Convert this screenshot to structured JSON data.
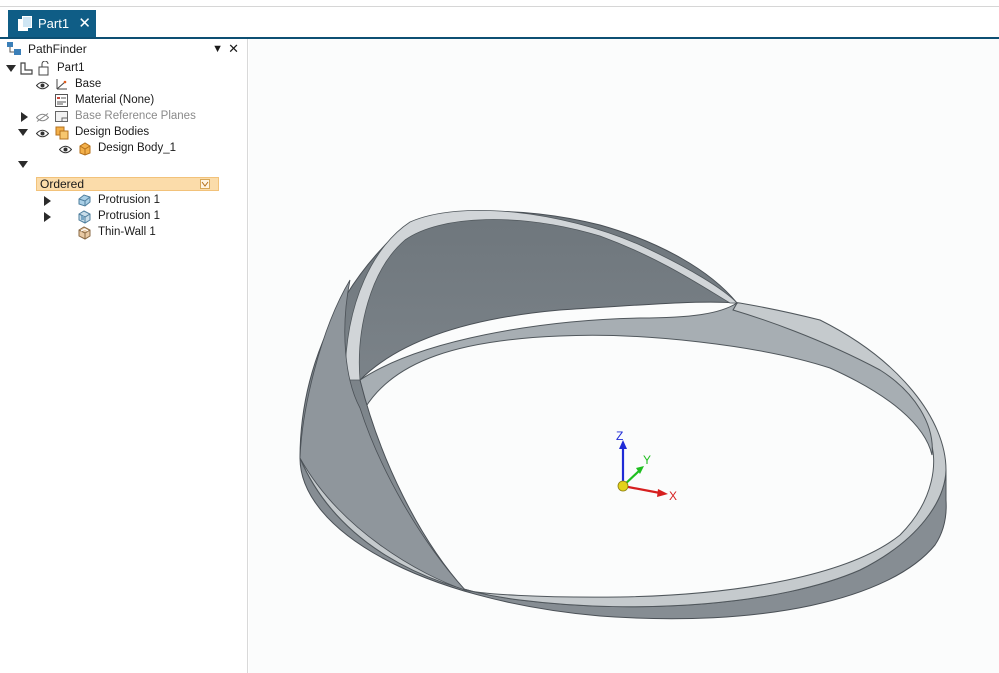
{
  "tabs": [
    {
      "label": "Part1",
      "close_glyph": "✕",
      "icon": "part-document-icon"
    }
  ],
  "pathfinder": {
    "title": "PathFinder",
    "pin_glyph": "▼",
    "close_glyph": "✕",
    "tree": {
      "root": "Part1",
      "base": "Base",
      "material": "Material (None)",
      "base_reference_planes": "Base Reference Planes",
      "design_bodies": "Design Bodies",
      "design_body_1": "Design Body_1",
      "ordered": "Ordered",
      "features": [
        "Protrusion 1",
        "Protrusion 1",
        "Thin-Wall 1"
      ]
    }
  },
  "triad": {
    "z": "Z",
    "y": "Y",
    "x": "X"
  },
  "colors": {
    "tab_active": "#0f5d86",
    "ordered_highlight": "#fbdcaa",
    "axis_z": "#1f2bd6",
    "axis_y": "#1fbf1f",
    "axis_x": "#d61f1f",
    "model_gray": "#8b9298"
  }
}
